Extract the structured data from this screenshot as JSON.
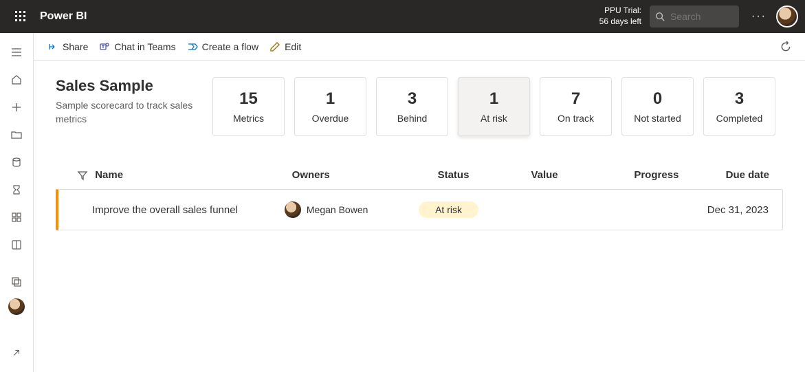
{
  "topbar": {
    "brand": "Power BI",
    "trial_line1": "PPU Trial:",
    "trial_line2": "56 days left",
    "search_placeholder": "Search"
  },
  "toolbar": {
    "share": "Share",
    "chat": "Chat in Teams",
    "flow": "Create a flow",
    "edit": "Edit"
  },
  "page": {
    "title": "Sales Sample",
    "subtitle": "Sample scorecard to track sales metrics"
  },
  "cards": [
    {
      "value": "15",
      "label": "Metrics",
      "active": false
    },
    {
      "value": "1",
      "label": "Overdue",
      "active": false
    },
    {
      "value": "3",
      "label": "Behind",
      "active": false
    },
    {
      "value": "1",
      "label": "At risk",
      "active": true
    },
    {
      "value": "7",
      "label": "On track",
      "active": false
    },
    {
      "value": "0",
      "label": "Not started",
      "active": false
    },
    {
      "value": "3",
      "label": "Completed",
      "active": false
    }
  ],
  "columns": {
    "name": "Name",
    "owners": "Owners",
    "status": "Status",
    "value": "Value",
    "progress": "Progress",
    "due": "Due date"
  },
  "rows": [
    {
      "name": "Improve the overall sales funnel",
      "owner": "Megan Bowen",
      "status": "At risk",
      "value": "",
      "progress": "",
      "due": "Dec 31, 2023",
      "accent": "#ff8c00"
    }
  ]
}
